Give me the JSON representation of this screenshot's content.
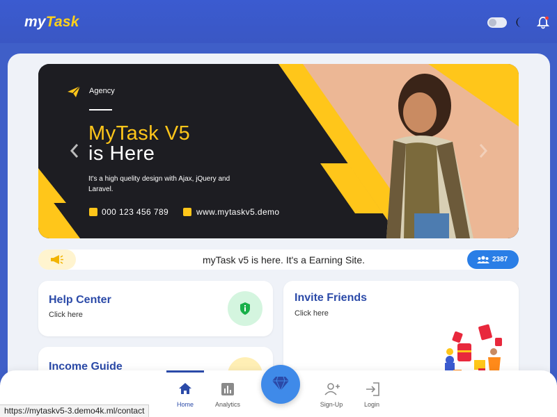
{
  "header": {
    "brand_prefix": "my",
    "brand_suffix": "Task",
    "theme_toggle": "off",
    "icons": [
      "moon-icon",
      "bell-icon"
    ],
    "accent_color": "#ffd21a"
  },
  "banner": {
    "tag": "Agency",
    "headline_line1": "MyTask V5",
    "headline_line2": "is Here",
    "description": "It's a high quelity design with Ajax, jQuery and Laravel.",
    "phone": "000 123 456 789",
    "website": "www.mytaskv5.demo",
    "icons": [
      "plane-icon",
      "phone-icon",
      "web-icon",
      "prev-icon",
      "next-icon"
    ]
  },
  "notice": {
    "text": "myTask v5 is here. It's a Earning Site.",
    "count": "2387",
    "icons": [
      "megaphone-icon",
      "users-icon"
    ]
  },
  "cards": {
    "help": {
      "title": "Help Center",
      "subtitle": "Click here",
      "icon": "shield-info-icon"
    },
    "income": {
      "title": "Income Guide"
    },
    "invite": {
      "title": "Invite Friends",
      "subtitle": "Click here"
    }
  },
  "bottom_nav": {
    "items": [
      {
        "label": "Home",
        "icon": "home-icon",
        "active": true
      },
      {
        "label": "Analytics",
        "icon": "chart-icon"
      },
      {
        "label": "Sign-Up",
        "icon": "user-plus-icon"
      },
      {
        "label": "Login",
        "icon": "login-icon"
      }
    ],
    "fab_icon": "diamond-icon"
  },
  "status_bar": {
    "url": "https://mytaskv5-3.demo4k.ml/contact"
  }
}
